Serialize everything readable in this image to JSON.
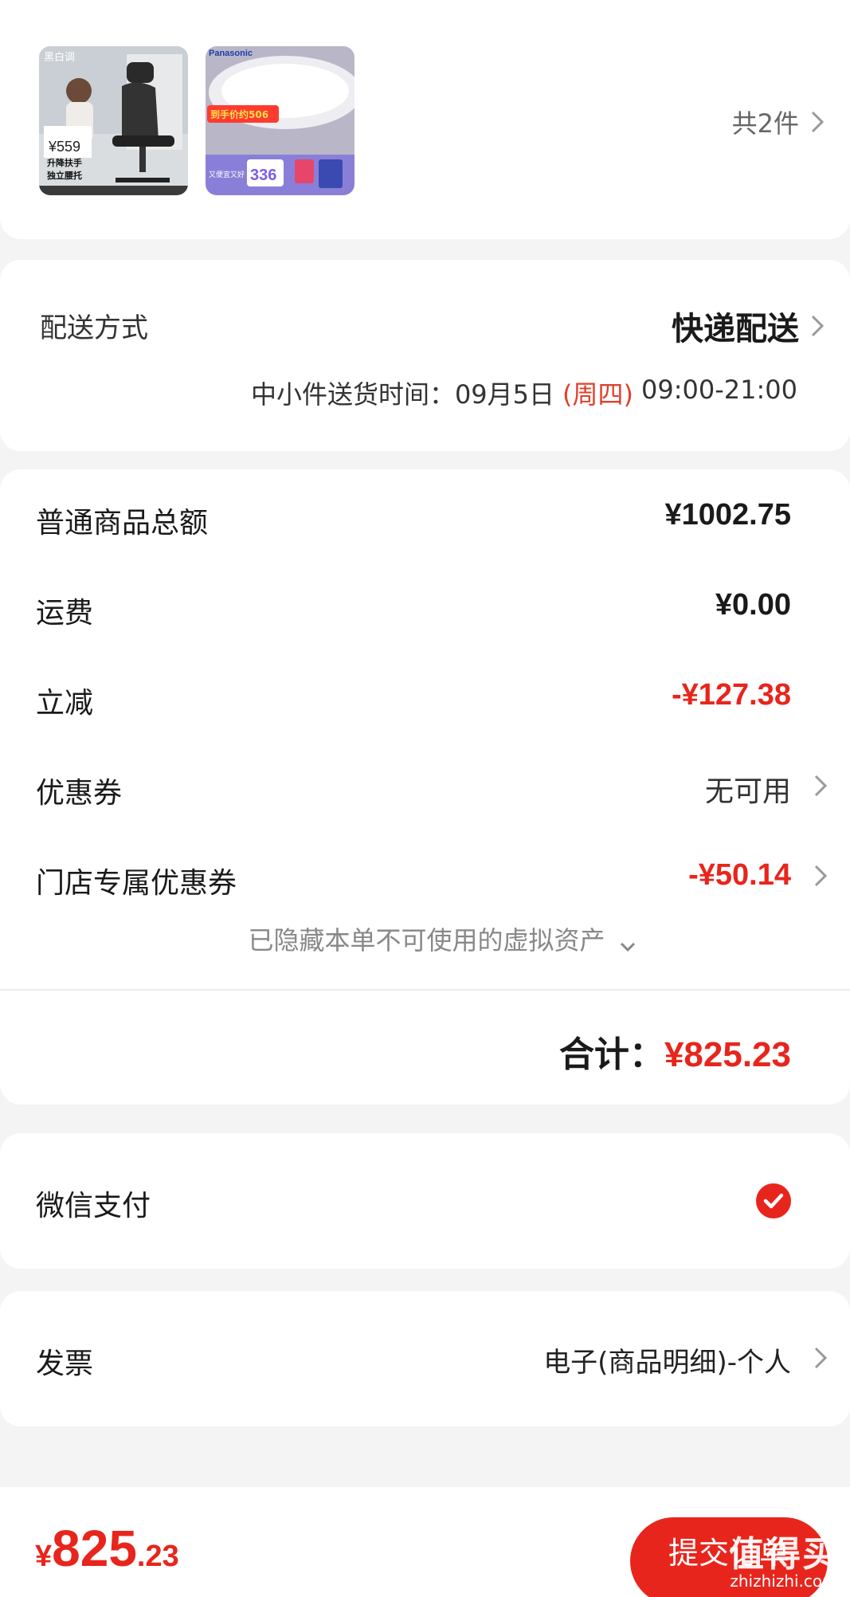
{
  "products": {
    "count_label": "共2件",
    "items": [
      {
        "icon": "office-chair-product-image",
        "brand": "黑白调",
        "price_tag": "¥559",
        "tag1": "升降扶手",
        "tag2": "独立腰托"
      },
      {
        "icon": "ceiling-lamp-product-image",
        "brand": "Panasonic",
        "price_tag": "到手价约506",
        "tag1": "又便宜又好",
        "price_big": "336"
      }
    ]
  },
  "delivery": {
    "label": "配送方式",
    "method": "快递配送",
    "time_prefix": "中小件送货时间：09月5日",
    "time_weekday": "(周四)",
    "time_range": "09:00-21:00"
  },
  "amounts": {
    "subtotal_label": "普通商品总额",
    "subtotal_value": "¥1002.75",
    "shipping_label": "运费",
    "shipping_value": "¥0.00",
    "discount_label": "立减",
    "discount_value": "-¥127.38",
    "coupon_label": "优惠券",
    "coupon_value": "无可用",
    "store_coupon_label": "门店专属优惠券",
    "store_coupon_value": "-¥50.14",
    "hidden_assets_note": "已隐藏本单不可使用的虚拟资产",
    "total_label": "合计：",
    "total_value": "¥825.23"
  },
  "payment": {
    "method_label": "微信支付",
    "selected": true
  },
  "invoice": {
    "label": "发票",
    "value": "电子(商品明细)-个人"
  },
  "bottom_bar": {
    "currency": "¥",
    "price_int": "825",
    "price_dec": ".23",
    "submit_label": "提交订单"
  },
  "watermark": {
    "text": "值得买",
    "domain": "zhizhizhi.com"
  },
  "colors": {
    "accent_red": "#e8251c",
    "weekday_red": "#e0402b",
    "background": "#f4f4f4"
  }
}
